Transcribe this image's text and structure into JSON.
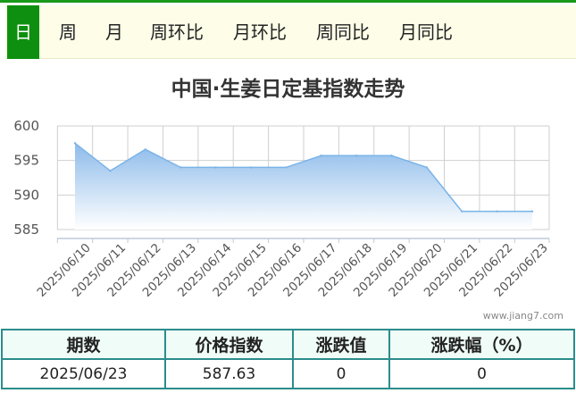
{
  "tabs": [
    {
      "label": "日",
      "active": true
    },
    {
      "label": "周",
      "active": false
    },
    {
      "label": "月",
      "active": false
    },
    {
      "label": "周环比",
      "active": false
    },
    {
      "label": "月环比",
      "active": false
    },
    {
      "label": "周同比",
      "active": false
    },
    {
      "label": "月同比",
      "active": false
    }
  ],
  "chart_data": {
    "type": "area",
    "title": "中国·生姜日定基指数走势",
    "xlabel": "",
    "ylabel": "",
    "categories": [
      "2025/06/10",
      "2025/06/11",
      "2025/06/12",
      "2025/06/13",
      "2025/06/14",
      "2025/06/15",
      "2025/06/16",
      "2025/06/17",
      "2025/06/18",
      "2025/06/19",
      "2025/06/20",
      "2025/06/21",
      "2025/06/22",
      "2025/06/23"
    ],
    "series": [
      {
        "values": [
          597.5,
          593.5,
          596.6,
          594.0,
          594.0,
          594.0,
          594.0,
          595.7,
          595.7,
          595.7,
          594.0,
          587.63,
          587.63,
          587.63
        ]
      }
    ],
    "ylim": [
      585,
      600
    ],
    "yticks": [
      585,
      590,
      595,
      600
    ],
    "grid": true,
    "colors": {
      "line": "#7ab4e8",
      "fill_top": "#8dbbea",
      "fill_bottom": "#ffffff",
      "grid": "#cfcfcf"
    }
  },
  "watermark": "www.jiang7.com",
  "table": {
    "headers": [
      "期数",
      "价格指数",
      "涨跌值",
      "涨跌幅（%）"
    ],
    "row": [
      "2025/06/23",
      "587.63",
      "0",
      "0"
    ]
  }
}
